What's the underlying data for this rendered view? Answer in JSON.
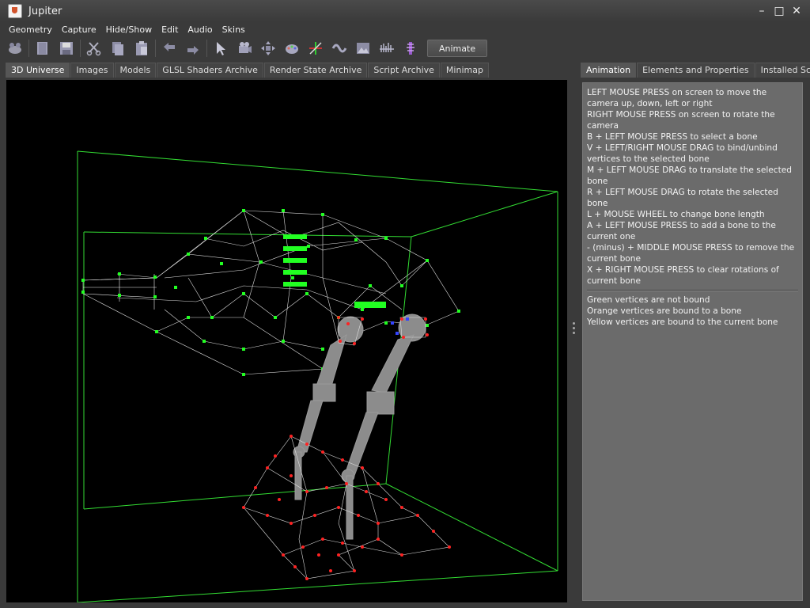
{
  "window": {
    "title": "Jupiter",
    "controls": [
      "–",
      "□",
      "✕"
    ]
  },
  "menu": [
    "Geometry",
    "Capture",
    "Hide/Show",
    "Edit",
    "Audio",
    "Skins"
  ],
  "toolbar": {
    "animate_label": "Animate"
  },
  "left_tabs": [
    "3D Universe",
    "Images",
    "Models",
    "GLSL Shaders Archive",
    "Render State Archive",
    "Script Archive",
    "Minimap"
  ],
  "right_tabs": [
    "Animation",
    "Elements and Properties",
    "Installed Scripts"
  ],
  "help": {
    "instructions": [
      "LEFT MOUSE PRESS on screen to move the camera up, down, left or right",
      "RIGHT MOUSE PRESS on screen to rotate the camera",
      "B + LEFT MOUSE PRESS to select a bone",
      "V + LEFT/RIGHT MOUSE DRAG to bind/unbind vertices to the selected bone",
      "M + LEFT MOUSE DRAG to translate the selected bone",
      "R + LEFT MOUSE DRAG to rotate the selected bone",
      "L + MOUSE WHEEL to change bone length",
      "A + LEFT MOUSE PRESS to add a bone to the current one",
      "- (minus) + MIDDLE MOUSE PRESS to remove the current bone",
      "X + RIGHT MOUSE PRESS to clear rotations of current bone"
    ],
    "legend": [
      "Green vertices are not bound",
      "Orange vertices are bound to a bone",
      "Yellow vertices are bound to the current bone"
    ]
  },
  "colors": {
    "bounding_box": "#33dd33",
    "unbound_vertex": "#22ff22",
    "bound_vertex": "#ff2222",
    "selected_vertex": "#3344ff"
  }
}
